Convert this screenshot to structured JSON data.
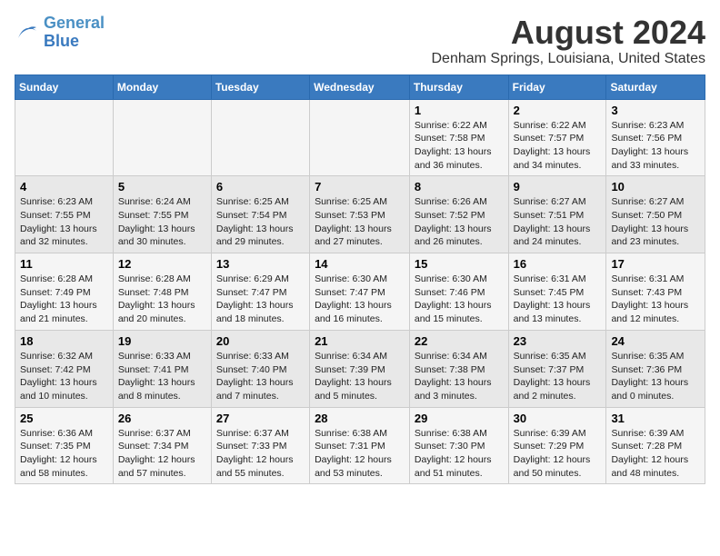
{
  "logo": {
    "line1": "General",
    "line2": "Blue"
  },
  "title": "August 2024",
  "location": "Denham Springs, Louisiana, United States",
  "weekdays": [
    "Sunday",
    "Monday",
    "Tuesday",
    "Wednesday",
    "Thursday",
    "Friday",
    "Saturday"
  ],
  "weeks": [
    [
      {
        "day": "",
        "info": ""
      },
      {
        "day": "",
        "info": ""
      },
      {
        "day": "",
        "info": ""
      },
      {
        "day": "",
        "info": ""
      },
      {
        "day": "1",
        "info": "Sunrise: 6:22 AM\nSunset: 7:58 PM\nDaylight: 13 hours\nand 36 minutes."
      },
      {
        "day": "2",
        "info": "Sunrise: 6:22 AM\nSunset: 7:57 PM\nDaylight: 13 hours\nand 34 minutes."
      },
      {
        "day": "3",
        "info": "Sunrise: 6:23 AM\nSunset: 7:56 PM\nDaylight: 13 hours\nand 33 minutes."
      }
    ],
    [
      {
        "day": "4",
        "info": "Sunrise: 6:23 AM\nSunset: 7:55 PM\nDaylight: 13 hours\nand 32 minutes."
      },
      {
        "day": "5",
        "info": "Sunrise: 6:24 AM\nSunset: 7:55 PM\nDaylight: 13 hours\nand 30 minutes."
      },
      {
        "day": "6",
        "info": "Sunrise: 6:25 AM\nSunset: 7:54 PM\nDaylight: 13 hours\nand 29 minutes."
      },
      {
        "day": "7",
        "info": "Sunrise: 6:25 AM\nSunset: 7:53 PM\nDaylight: 13 hours\nand 27 minutes."
      },
      {
        "day": "8",
        "info": "Sunrise: 6:26 AM\nSunset: 7:52 PM\nDaylight: 13 hours\nand 26 minutes."
      },
      {
        "day": "9",
        "info": "Sunrise: 6:27 AM\nSunset: 7:51 PM\nDaylight: 13 hours\nand 24 minutes."
      },
      {
        "day": "10",
        "info": "Sunrise: 6:27 AM\nSunset: 7:50 PM\nDaylight: 13 hours\nand 23 minutes."
      }
    ],
    [
      {
        "day": "11",
        "info": "Sunrise: 6:28 AM\nSunset: 7:49 PM\nDaylight: 13 hours\nand 21 minutes."
      },
      {
        "day": "12",
        "info": "Sunrise: 6:28 AM\nSunset: 7:48 PM\nDaylight: 13 hours\nand 20 minutes."
      },
      {
        "day": "13",
        "info": "Sunrise: 6:29 AM\nSunset: 7:47 PM\nDaylight: 13 hours\nand 18 minutes."
      },
      {
        "day": "14",
        "info": "Sunrise: 6:30 AM\nSunset: 7:47 PM\nDaylight: 13 hours\nand 16 minutes."
      },
      {
        "day": "15",
        "info": "Sunrise: 6:30 AM\nSunset: 7:46 PM\nDaylight: 13 hours\nand 15 minutes."
      },
      {
        "day": "16",
        "info": "Sunrise: 6:31 AM\nSunset: 7:45 PM\nDaylight: 13 hours\nand 13 minutes."
      },
      {
        "day": "17",
        "info": "Sunrise: 6:31 AM\nSunset: 7:43 PM\nDaylight: 13 hours\nand 12 minutes."
      }
    ],
    [
      {
        "day": "18",
        "info": "Sunrise: 6:32 AM\nSunset: 7:42 PM\nDaylight: 13 hours\nand 10 minutes."
      },
      {
        "day": "19",
        "info": "Sunrise: 6:33 AM\nSunset: 7:41 PM\nDaylight: 13 hours\nand 8 minutes."
      },
      {
        "day": "20",
        "info": "Sunrise: 6:33 AM\nSunset: 7:40 PM\nDaylight: 13 hours\nand 7 minutes."
      },
      {
        "day": "21",
        "info": "Sunrise: 6:34 AM\nSunset: 7:39 PM\nDaylight: 13 hours\nand 5 minutes."
      },
      {
        "day": "22",
        "info": "Sunrise: 6:34 AM\nSunset: 7:38 PM\nDaylight: 13 hours\nand 3 minutes."
      },
      {
        "day": "23",
        "info": "Sunrise: 6:35 AM\nSunset: 7:37 PM\nDaylight: 13 hours\nand 2 minutes."
      },
      {
        "day": "24",
        "info": "Sunrise: 6:35 AM\nSunset: 7:36 PM\nDaylight: 13 hours\nand 0 minutes."
      }
    ],
    [
      {
        "day": "25",
        "info": "Sunrise: 6:36 AM\nSunset: 7:35 PM\nDaylight: 12 hours\nand 58 minutes."
      },
      {
        "day": "26",
        "info": "Sunrise: 6:37 AM\nSunset: 7:34 PM\nDaylight: 12 hours\nand 57 minutes."
      },
      {
        "day": "27",
        "info": "Sunrise: 6:37 AM\nSunset: 7:33 PM\nDaylight: 12 hours\nand 55 minutes."
      },
      {
        "day": "28",
        "info": "Sunrise: 6:38 AM\nSunset: 7:31 PM\nDaylight: 12 hours\nand 53 minutes."
      },
      {
        "day": "29",
        "info": "Sunrise: 6:38 AM\nSunset: 7:30 PM\nDaylight: 12 hours\nand 51 minutes."
      },
      {
        "day": "30",
        "info": "Sunrise: 6:39 AM\nSunset: 7:29 PM\nDaylight: 12 hours\nand 50 minutes."
      },
      {
        "day": "31",
        "info": "Sunrise: 6:39 AM\nSunset: 7:28 PM\nDaylight: 12 hours\nand 48 minutes."
      }
    ]
  ]
}
